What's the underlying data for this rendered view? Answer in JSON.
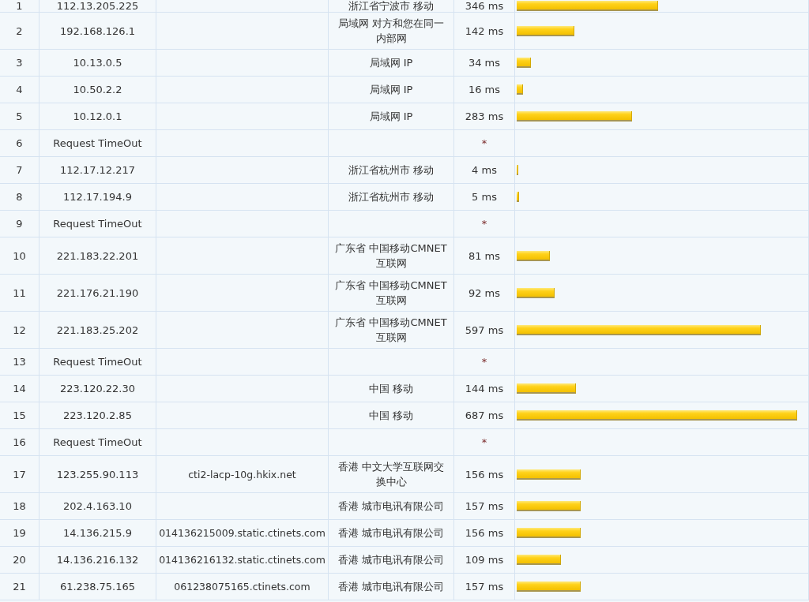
{
  "hops": [
    {
      "hop": "1",
      "ip": "112.13.205.225",
      "location": "浙江省宁波市 移动",
      "time": "346 ms",
      "level": 0.487
    },
    {
      "hop": "2",
      "ip": "192.168.126.1",
      "location": "局域网 对方和您在同一内部网",
      "time": "142 ms",
      "level": 0.2
    },
    {
      "hop": "3",
      "ip": "10.13.0.5",
      "location": "局域网 IP",
      "time": "34 ms",
      "level": 0.048
    },
    {
      "hop": "4",
      "ip": "10.50.2.2",
      "location": "局域网 IP",
      "time": "16 ms",
      "level": 0.023
    },
    {
      "hop": "5",
      "ip": "10.12.0.1",
      "location": "局域网 IP",
      "time": "283 ms",
      "level": 0.398
    },
    {
      "hop": "6",
      "ip": "Request TimeOut",
      "time": "*"
    },
    {
      "hop": "7",
      "ip": "112.17.12.217",
      "location": "浙江省杭州市 移动",
      "time": "4 ms",
      "level": 0.006
    },
    {
      "hop": "8",
      "ip": "112.17.194.9",
      "location": "浙江省杭州市 移动",
      "time": "5 ms",
      "level": 0.007
    },
    {
      "hop": "9",
      "ip": "Request TimeOut",
      "time": "*"
    },
    {
      "hop": "10",
      "ip": "221.183.22.201",
      "location": "广东省 中国移动CMNET互联网",
      "time": "81 ms",
      "level": 0.114
    },
    {
      "hop": "11",
      "ip": "221.176.21.190",
      "location": "广东省 中国移动CMNET互联网",
      "time": "92 ms",
      "level": 0.13
    },
    {
      "hop": "12",
      "ip": "221.183.25.202",
      "location": "广东省 中国移动CMNET互联网",
      "time": "597 ms",
      "level": 0.841
    },
    {
      "hop": "13",
      "ip": "Request TimeOut",
      "time": "*"
    },
    {
      "hop": "14",
      "ip": "223.120.22.30",
      "location": "中国 移动",
      "time": "144 ms",
      "level": 0.203
    },
    {
      "hop": "15",
      "ip": "223.120.2.85",
      "location": "中国 移动",
      "time": "687 ms",
      "level": 0.967
    },
    {
      "hop": "16",
      "ip": "Request TimeOut",
      "time": "*"
    },
    {
      "hop": "17",
      "ip": "123.255.90.113",
      "host": "cti2-lacp-10g.hkix.net",
      "location": "香港 中文大学互联网交换中心",
      "time": "156 ms",
      "level": 0.22
    },
    {
      "hop": "18",
      "ip": "202.4.163.10",
      "location": "香港 城市电讯有限公司",
      "time": "157 ms",
      "level": 0.221
    },
    {
      "hop": "19",
      "ip": "14.136.215.9",
      "host": "014136215009.static.ctinets.com",
      "location": "香港 城市电讯有限公司",
      "time": "156 ms",
      "level": 0.22
    },
    {
      "hop": "20",
      "ip": "14.136.216.132",
      "host": "014136216132.static.ctinets.com",
      "location": "香港 城市电讯有限公司",
      "time": "109 ms",
      "level": 0.153
    },
    {
      "hop": "21",
      "ip": "61.238.75.165",
      "host": "061238075165.ctinets.com",
      "location": "香港 城市电讯有限公司",
      "time": "157 ms",
      "level": 0.221
    }
  ]
}
